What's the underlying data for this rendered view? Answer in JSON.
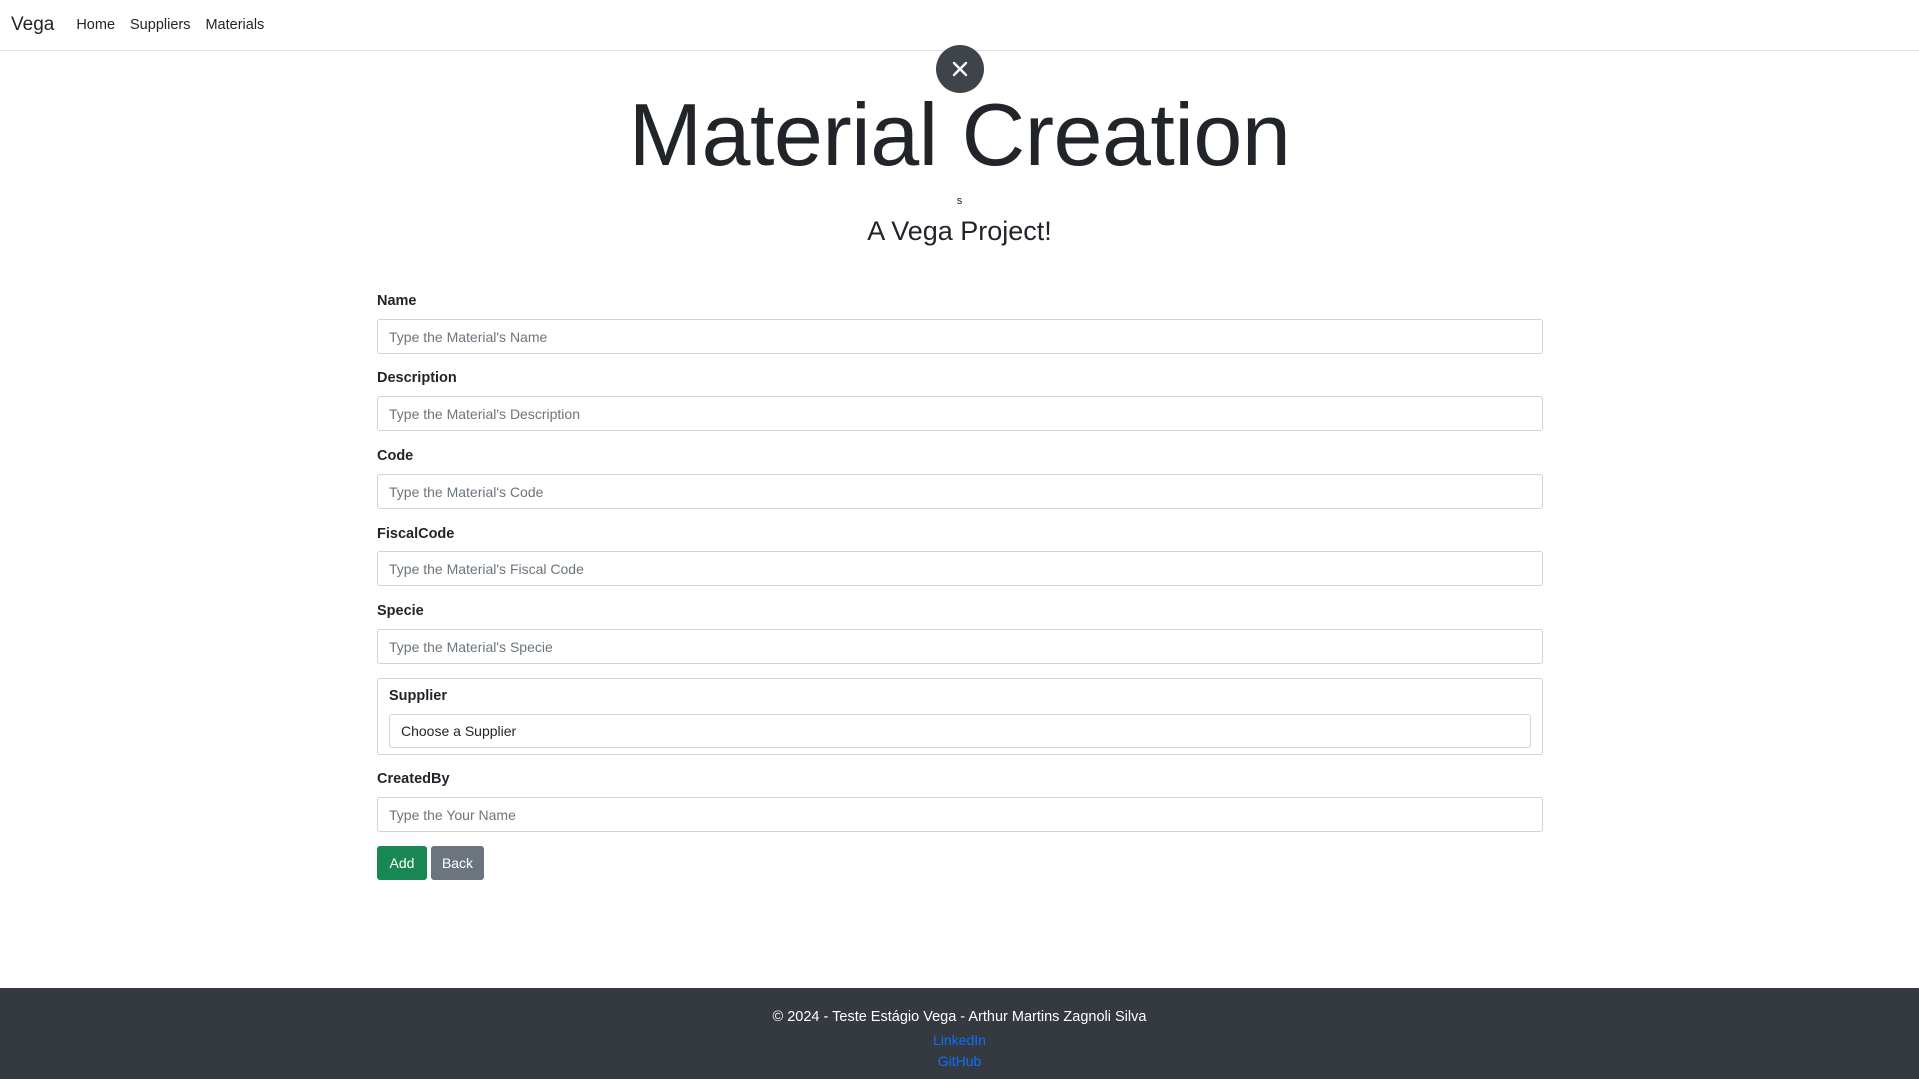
{
  "navbar": {
    "brand": "Vega",
    "links": [
      "Home",
      "Suppliers",
      "Materials"
    ]
  },
  "header": {
    "title": "Material Creation",
    "small_text": "s",
    "subtitle": "A Vega Project!"
  },
  "form": {
    "fields": [
      {
        "label": "Name",
        "placeholder": "Type the Material's Name",
        "value": ""
      },
      {
        "label": "Description",
        "placeholder": "Type the Material's Description",
        "value": ""
      },
      {
        "label": "Code",
        "placeholder": "Type the Material's Code",
        "value": ""
      },
      {
        "label": "FiscalCode",
        "placeholder": "Type the Material's Fiscal Code",
        "value": ""
      },
      {
        "label": "Specie",
        "placeholder": "Type the Material's Specie",
        "value": ""
      }
    ],
    "supplier": {
      "label": "Supplier",
      "selected": "Choose a Supplier"
    },
    "created_by": {
      "label": "CreatedBy",
      "placeholder": "Type the Your Name",
      "value": ""
    },
    "add_label": "Add",
    "back_label": "Back"
  },
  "footer": {
    "copyright": "© 2024 - Teste Estágio Vega - Arthur Martins Zagnoli Silva",
    "links": [
      "LinkedIn",
      "GitHub"
    ]
  },
  "colors": {
    "success": "#198754",
    "secondary": "#6c757d",
    "footer_bg": "#343a40",
    "link": "#0d6efd"
  },
  "icons": {
    "close": "close-icon"
  }
}
